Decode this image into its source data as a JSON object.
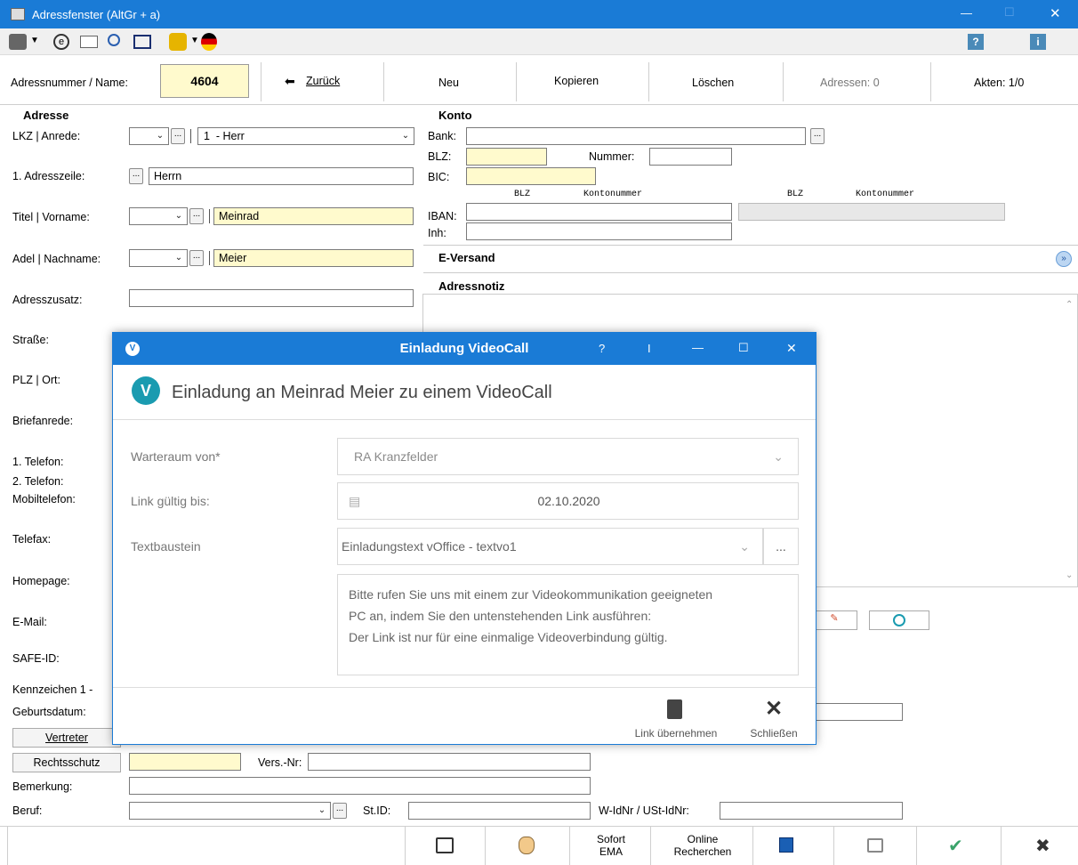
{
  "window": {
    "title": "Adressfenster (AltGr + a)",
    "minimize": "—",
    "maximize": "☐",
    "close": "✕"
  },
  "toolbar": {
    "help_glyph": "?",
    "info_glyph": "i"
  },
  "nav": {
    "address_label": "Adressnummer / Name:",
    "address_number": "4604",
    "back": "Zurück",
    "new": "Neu",
    "copy": "Kopieren",
    "delete": "Löschen",
    "addresses": "Adressen: 0",
    "files": "Akten: 1/0"
  },
  "adresse": {
    "heading": "Adresse",
    "lkz_label": "LKZ | Anrede:",
    "anrede_value": "1  - Herr",
    "adresszeile_label": "1. Adresszeile:",
    "adresszeile_value": "Herrn",
    "titel_label": "Titel | Vorname:",
    "vorname_value": "Meinrad",
    "adel_label": "Adel | Nachname:",
    "nachname_value": "Meier",
    "zusatz_label": "Adresszusatz:",
    "strasse_label": "Straße:",
    "plz_label": "PLZ | Ort:",
    "briefanrede_label": "Briefanrede:",
    "tel1_label": "1. Telefon:",
    "tel2_label": "2. Telefon:",
    "mobil_label": "Mobiltelefon:",
    "fax_label": "Telefax:",
    "homepage_label": "Homepage:",
    "email_label": "E-Mail:",
    "safe_label": "SAFE-ID:",
    "kennzeichen_label": "Kennzeichen 1 -",
    "geburt_label": "Geburtsdatum:",
    "vertreter_button": "Vertreter",
    "rechtsschutz_button": "Rechtsschutz",
    "versnr_label": "Vers.-Nr:",
    "bemerkung_label": "Bemerkung:",
    "beruf_label": "Beruf:",
    "stid_label": "St.ID:",
    "wid_label": "W-IdNr / USt-IdNr:"
  },
  "konto": {
    "heading": "Konto",
    "bank_label": "Bank:",
    "blz_label": "BLZ:",
    "nummer_label": "Nummer:",
    "bic_label": "BIC:",
    "col_blz": "BLZ",
    "col_konto": "Kontonummer",
    "col_blz2": "BLZ",
    "col_konto2": "Kontonummer",
    "iban_label": "IBAN:",
    "inh_label": "Inh:"
  },
  "eversand": {
    "heading": "E-Versand"
  },
  "notiz": {
    "heading": "Adressnotiz"
  },
  "dialog": {
    "title": "Einladung VideoCall",
    "title_help": "?",
    "title_pin": "I",
    "title_min": "—",
    "title_max": "☐",
    "title_close": "✕",
    "heading": "Einladung an Meinrad Meier zu einem VideoCall",
    "warteraum_label": "Warteraum von*",
    "warteraum_value": "RA Kranzfelder",
    "link_label": "Link gültig bis:",
    "link_value": "02.10.2020",
    "textbaustein_label": "Textbaustein",
    "textbaustein_value": "Einladungstext vOffice - textvo1",
    "textbaustein_more": "...",
    "message_lines": [
      "Bitte rufen Sie uns mit einem zur Videokommunikation geeigneten",
      "PC an, indem Sie den untenstehenden Link ausführen:",
      "Der Link ist nur für eine einmalige Videoverbindung gültig."
    ],
    "link_button": "Link übernehmen",
    "close_button": "Schließen"
  },
  "bottom": {
    "sofort_ema_1": "Sofort",
    "sofort_ema_2": "EMA",
    "online_1": "Online",
    "online_2": "Recherchen"
  }
}
